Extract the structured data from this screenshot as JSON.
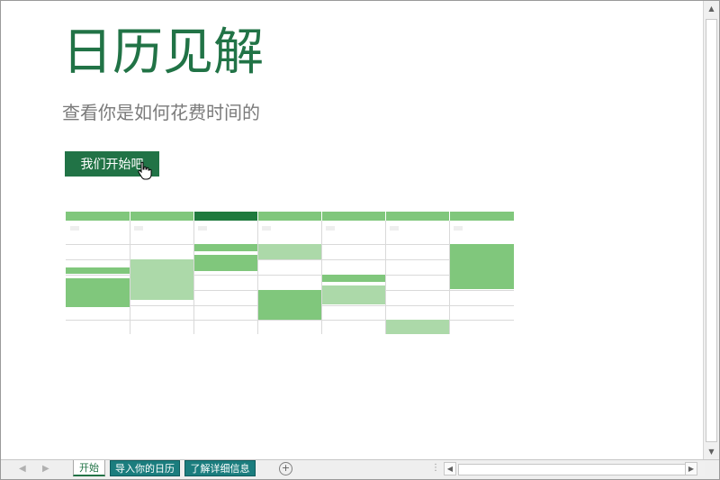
{
  "intro": {
    "title": "日历见解",
    "subtitle": "查看你是如何花费时间的",
    "start_button_label": "我们开始吧"
  },
  "sheet_tabs": [
    {
      "label": "开始",
      "state": "active"
    },
    {
      "label": "导入你的日历",
      "state": "inactive"
    },
    {
      "label": "了解详细信息",
      "state": "inactive"
    }
  ],
  "icons": {
    "add_sheet": "plus-circle-icon",
    "cursor": "hand-pointer-icon",
    "scroll_up": "chevron-up-icon",
    "scroll_down": "chevron-down-icon",
    "scroll_left": "chevron-left-icon",
    "scroll_right": "chevron-right-icon"
  },
  "colors": {
    "brand_green": "#217346",
    "tab_teal": "#1b7d7e",
    "cal_header": "#80c77c",
    "cal_header_selected": "#1f7a3e",
    "event_dark": "#80c77c",
    "event_light": "#acd9a9"
  }
}
